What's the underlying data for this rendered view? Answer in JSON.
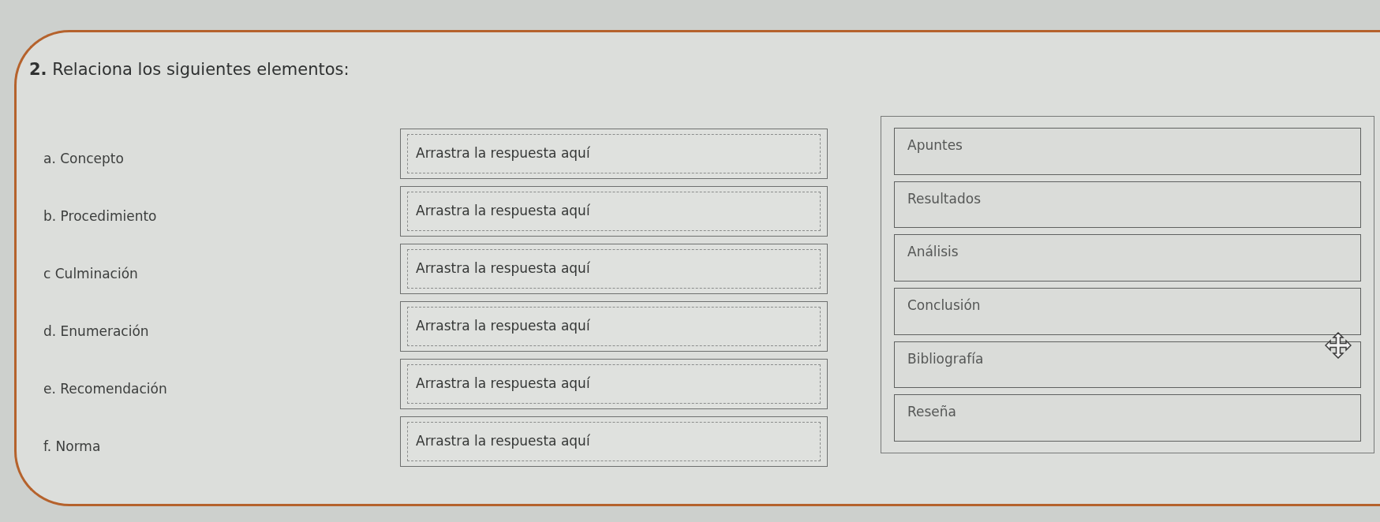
{
  "question": {
    "text": "**2.** Relaciona los siguientes elementos:"
  },
  "pairs": [
    {
      "label": "a. Concepto",
      "hint": "Arrastra la respuesta aquí"
    },
    {
      "label": "b. Procedimiento",
      "hint": "Arrastra la respuesta aquí"
    },
    {
      "label": "c Culminación",
      "hint": "Arrastra la respuesta aquí"
    },
    {
      "label": "d. Enumeración",
      "hint": "Arrastra la respuesta aquí"
    },
    {
      "label": "e. Recomendación",
      "hint": "Arrastra la respuesta aquí"
    },
    {
      "label": "f. Norma",
      "hint": "Arrastra la respuesta aquí"
    }
  ],
  "answers": [
    "Apuntes",
    "Resultados",
    "Análisis",
    "Conclusión",
    "Bibliografía",
    "Reseña"
  ]
}
